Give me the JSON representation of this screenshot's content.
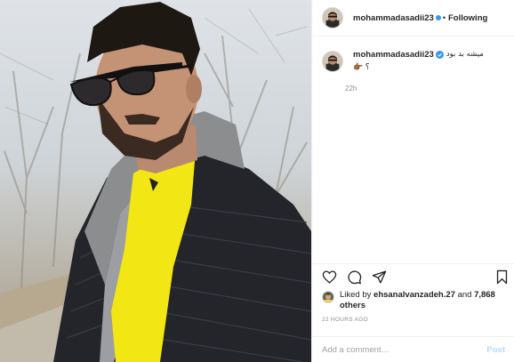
{
  "post": {
    "author": "mohammadasadii23",
    "follow_separator": "•",
    "follow_label": "Following",
    "caption_author": "mohammadasadii23",
    "caption_text": "میشه بد بود",
    "caption_line2": "؟ 👉🏾",
    "caption_time": "22h",
    "likes_prefix": "Liked by",
    "likes_user": "ehsanalvanzadeh.27",
    "likes_and": "and",
    "likes_count": "7,868 others",
    "posted_ago": "22 HOURS AGO",
    "comment_placeholder": "Add a comment…",
    "post_label": "Post"
  },
  "icons": {
    "verified": "verified-badge-icon",
    "like": "heart-icon",
    "comment": "comment-bubble-icon",
    "share": "paper-plane-icon",
    "save": "bookmark-icon"
  },
  "colors": {
    "verified": "#3897f0",
    "post_button_disabled": "#b3dbff",
    "muted_text": "#8e8e8e",
    "jacket_yellow": "#f2e614"
  }
}
